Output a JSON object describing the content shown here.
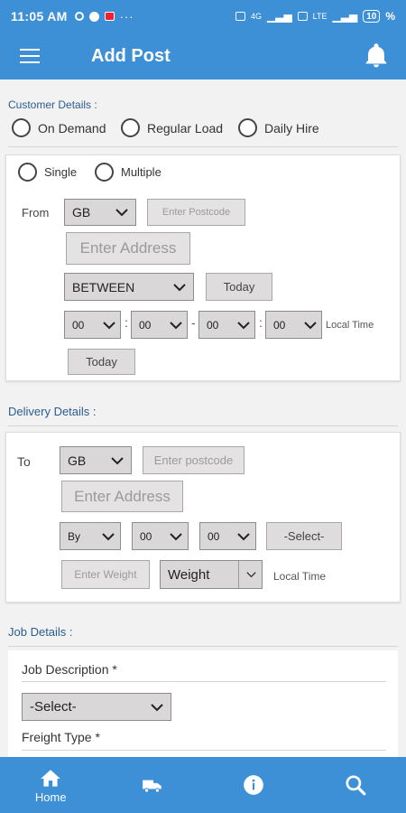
{
  "status_bar": {
    "time": "11:05 AM",
    "signal_labels": [
      "4G",
      "LTE"
    ],
    "battery": "10"
  },
  "header": {
    "title": "Add Post",
    "menu_icon": "hamburger-menu-icon",
    "notification_icon": "bell-icon"
  },
  "customer_details": {
    "label": "Customer Details :",
    "options": [
      "On Demand",
      "Regular Load",
      "Daily Hire"
    ]
  },
  "pickup": {
    "mode_options": [
      "Single",
      "Multiple"
    ],
    "from_label": "From",
    "country": "GB",
    "postcode_placeholder": "Enter Postcode",
    "address_placeholder": "Enter Address",
    "time_mode": "BETWEEN",
    "date_button": "Today",
    "time_from_hour": "00",
    "time_from_min": "00",
    "time_to_hour": "00",
    "time_to_min": "00",
    "colon": ":",
    "dash": "-",
    "local_time": "Local Time",
    "date_button_2": "Today"
  },
  "delivery_details": {
    "label": "Delivery Details :",
    "to_label": "To",
    "country": "GB",
    "postcode_placeholder": "Enter postcode",
    "address_placeholder": "Enter Address",
    "time_mode": "By",
    "hour": "00",
    "minute": "00",
    "select_placeholder": "-Select-",
    "weight_placeholder": "Enter Weight",
    "weight_unit": "Weight",
    "local_time": "Local Time"
  },
  "job_details": {
    "label": "Job Details :",
    "job_description_label": "Job Description *",
    "job_description_value": "-Select-",
    "freight_type_label": "Freight Type *"
  },
  "bottom_nav": {
    "items": [
      {
        "label": "Home",
        "icon": "home-icon"
      },
      {
        "label": "",
        "icon": "truck-icon"
      },
      {
        "label": "",
        "icon": "info-icon"
      },
      {
        "label": "",
        "icon": "search-icon"
      }
    ]
  },
  "colors": {
    "primary": "#3d8fd6",
    "label": "#2a5d8f",
    "field": "#d9d7d7"
  }
}
